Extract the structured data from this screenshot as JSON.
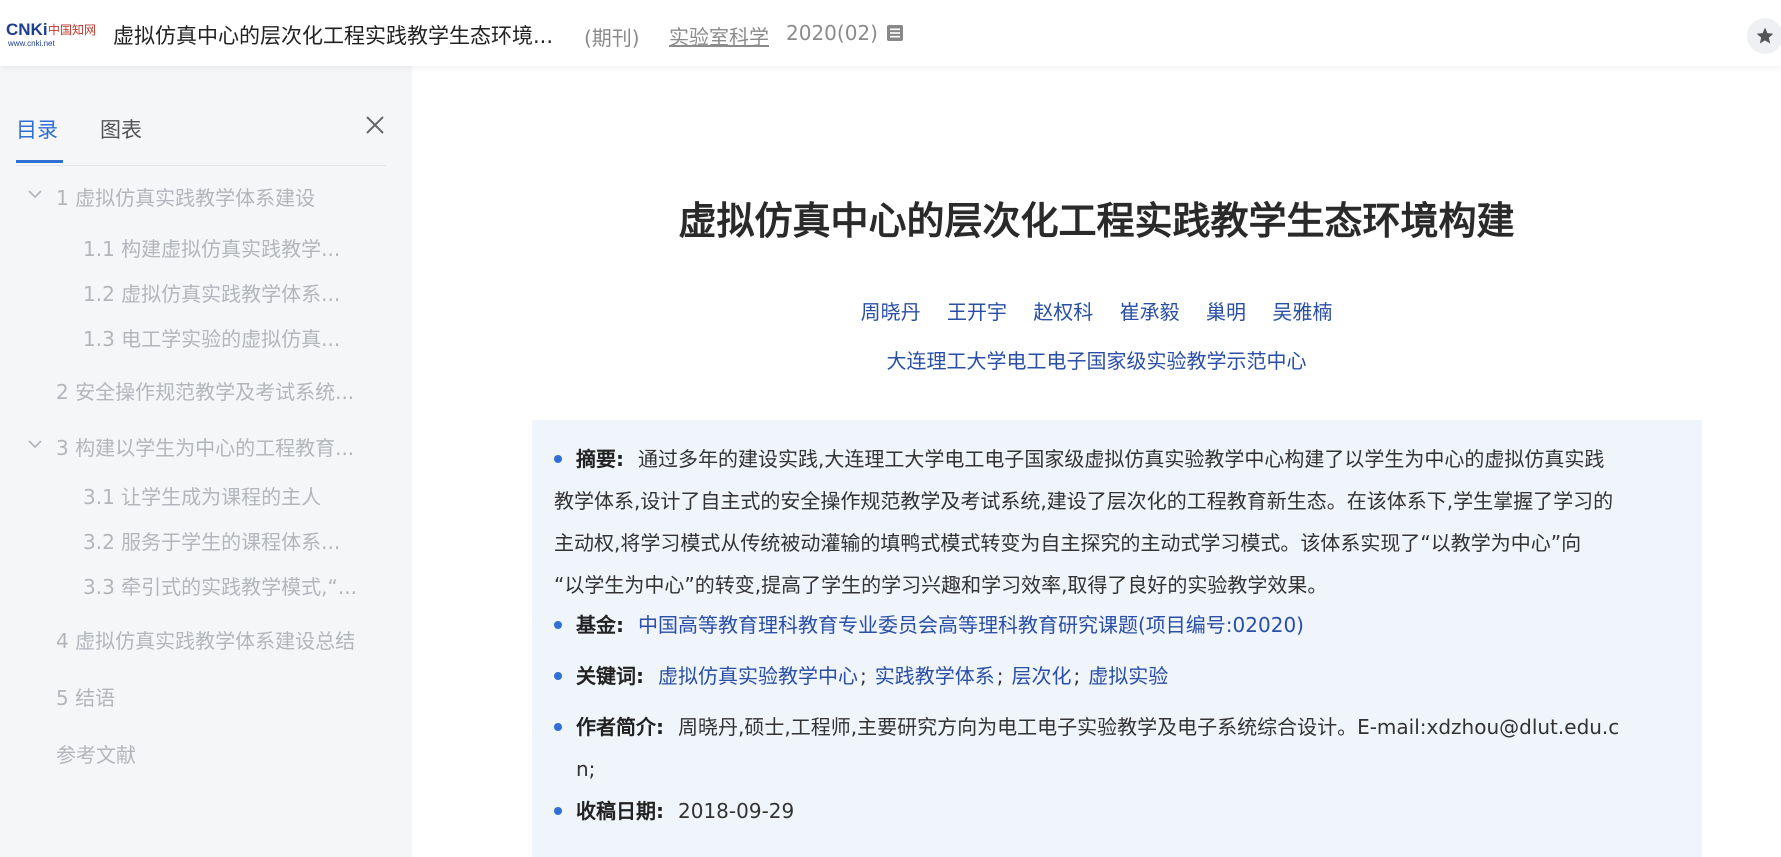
{
  "header": {
    "logo_text": "CNKi中国知网 www.cnki.net",
    "doc_title": "虚拟仿真中心的层次化工程实践教学生态环境...",
    "doc_type": "(期刊)",
    "journal": "实验室科学",
    "issue": "2020(02)"
  },
  "sidebar": {
    "tabs": [
      {
        "label": "目录"
      },
      {
        "label": "图表"
      }
    ],
    "toc": [
      {
        "label": "1 虚拟仿真实践教学体系建设"
      },
      {
        "label": "1.1 构建虚拟仿真实践教学..."
      },
      {
        "label": "1.2 虚拟仿真实践教学体系..."
      },
      {
        "label": "1.3 电工学实验的虚拟仿真..."
      },
      {
        "label": "2 安全操作规范教学及考试系统..."
      },
      {
        "label": "3 构建以学生为中心的工程教育..."
      },
      {
        "label": "3.1 让学生成为课程的主人"
      },
      {
        "label": "3.2 服务于学生的课程体系..."
      },
      {
        "label": "3.3 牵引式的实践教学模式,“..."
      },
      {
        "label": "4 虚拟仿真实践教学体系建设总结"
      },
      {
        "label": "5 结语"
      },
      {
        "label": "参考文献"
      }
    ]
  },
  "article": {
    "title": "虚拟仿真中心的层次化工程实践教学生态环境构建",
    "authors": [
      "周晓丹",
      "王开宇",
      "赵权科",
      "崔承毅",
      "巢明",
      "吴雅楠"
    ],
    "affiliation": "大连理工大学电工电子国家级实验教学示范中心",
    "abstract_label": "摘要:",
    "abstract_line1": "通过多年的建设实践,大连理工大学电工电子国家级虚拟仿真实验教学中心构建了以学生为中心的虚拟仿真实践",
    "abstract_line2": "教学体系,设计了自主式的安全操作规范教学及考试系统,建设了层次化的工程教育新生态。在该体系下,学生掌握了学习的",
    "abstract_line3": "主动权,将学习模式从传统被动灌输的填鸭式模式转变为自主探究的主动式学习模式。该体系实现了“以教学为中心”向",
    "abstract_line4": "“以学生为中心”的转变,提高了学生的学习兴趣和学习效率,取得了良好的实验教学效果。",
    "fund_label": "基金:",
    "fund": "中国高等教育理科教育专业委员会高等理科教育研究课题(项目编号:02020)",
    "keywords_label": "关键词:",
    "keywords": [
      "虚拟仿真实验教学中心",
      "实践教学体系",
      "层次化",
      "虚拟实验"
    ],
    "keyword_sep": ";",
    "bio_label": "作者简介:",
    "bio_line1": "周晓丹,硕士,工程师,主要研究方向为电工电子实验教学及电子系统综合设计。E-mail:xdzhou@dlut.edu.c",
    "bio_line2": "n;",
    "received_label": "收稿日期:",
    "received": "2018-09-29"
  },
  "colors": {
    "accent": "#2f6fd6",
    "link": "#2a4fa6",
    "sidebar_bg": "#f5f6f8",
    "info_bg": "#f0f4fb",
    "toc_text": "#b3b6bb"
  },
  "icons": [
    "cnki-logo",
    "list-icon",
    "star-icon",
    "close-icon",
    "chevron-down-icon"
  ]
}
